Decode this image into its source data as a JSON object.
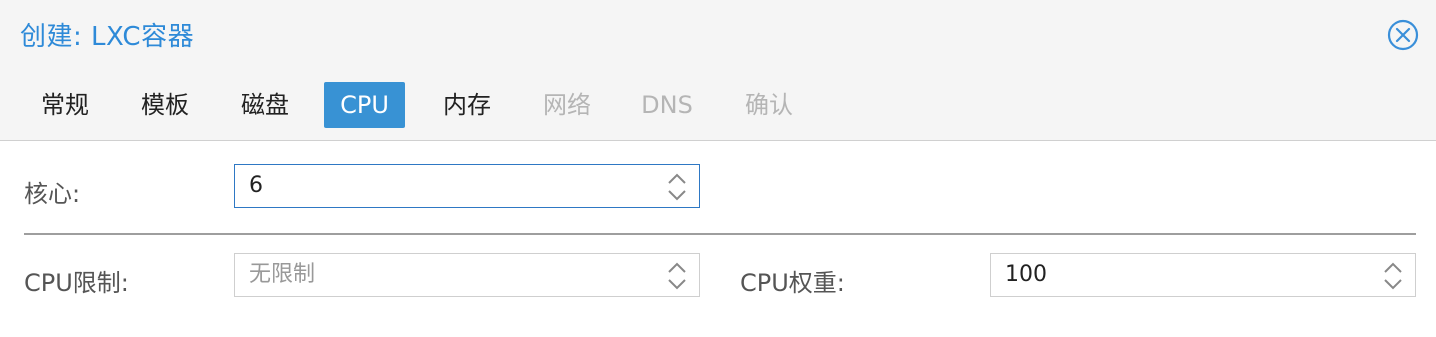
{
  "dialog": {
    "title": "创建: LXC容器",
    "close_icon": "close-circle-icon"
  },
  "tabs": [
    {
      "label": "常规",
      "state": "normal"
    },
    {
      "label": "模板",
      "state": "normal"
    },
    {
      "label": "磁盘",
      "state": "normal"
    },
    {
      "label": "CPU",
      "state": "active"
    },
    {
      "label": "内存",
      "state": "normal"
    },
    {
      "label": "网络",
      "state": "disabled"
    },
    {
      "label": "DNS",
      "state": "disabled"
    },
    {
      "label": "确认",
      "state": "disabled"
    }
  ],
  "form": {
    "cores": {
      "label": "核心:",
      "value": "6"
    },
    "cpu_limit": {
      "label": "CPU限制:",
      "placeholder": "无限制",
      "value": ""
    },
    "cpu_weight": {
      "label": "CPU权重:",
      "value": "100"
    }
  },
  "colors": {
    "accent": "#3892d4",
    "title": "#2e8ad8",
    "disabled_text": "#b5b5b5"
  }
}
